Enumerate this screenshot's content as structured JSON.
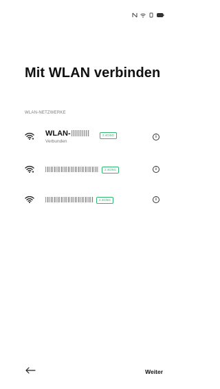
{
  "status_bar": {
    "icons": [
      "nfc-icon",
      "wifi-icon",
      "vibrate-icon",
      "battery-icon"
    ]
  },
  "page": {
    "title": "Mit WLAN verbinden",
    "section_header": "WLAN-NETZWERKE"
  },
  "networks": [
    {
      "name_prefix": "WLAN-",
      "badge": "2.4G/5G",
      "status": "Verbunden",
      "connected": true
    },
    {
      "badge": "2.4G/5G",
      "connected": false
    },
    {
      "badge": "2.4G/5G",
      "connected": false
    }
  ],
  "footer": {
    "back_icon": "arrow-left-icon",
    "next_label": "Weiter"
  },
  "colors": {
    "badge": "#2fb772",
    "text_primary": "#111111",
    "text_secondary": "#7a7a7a"
  }
}
